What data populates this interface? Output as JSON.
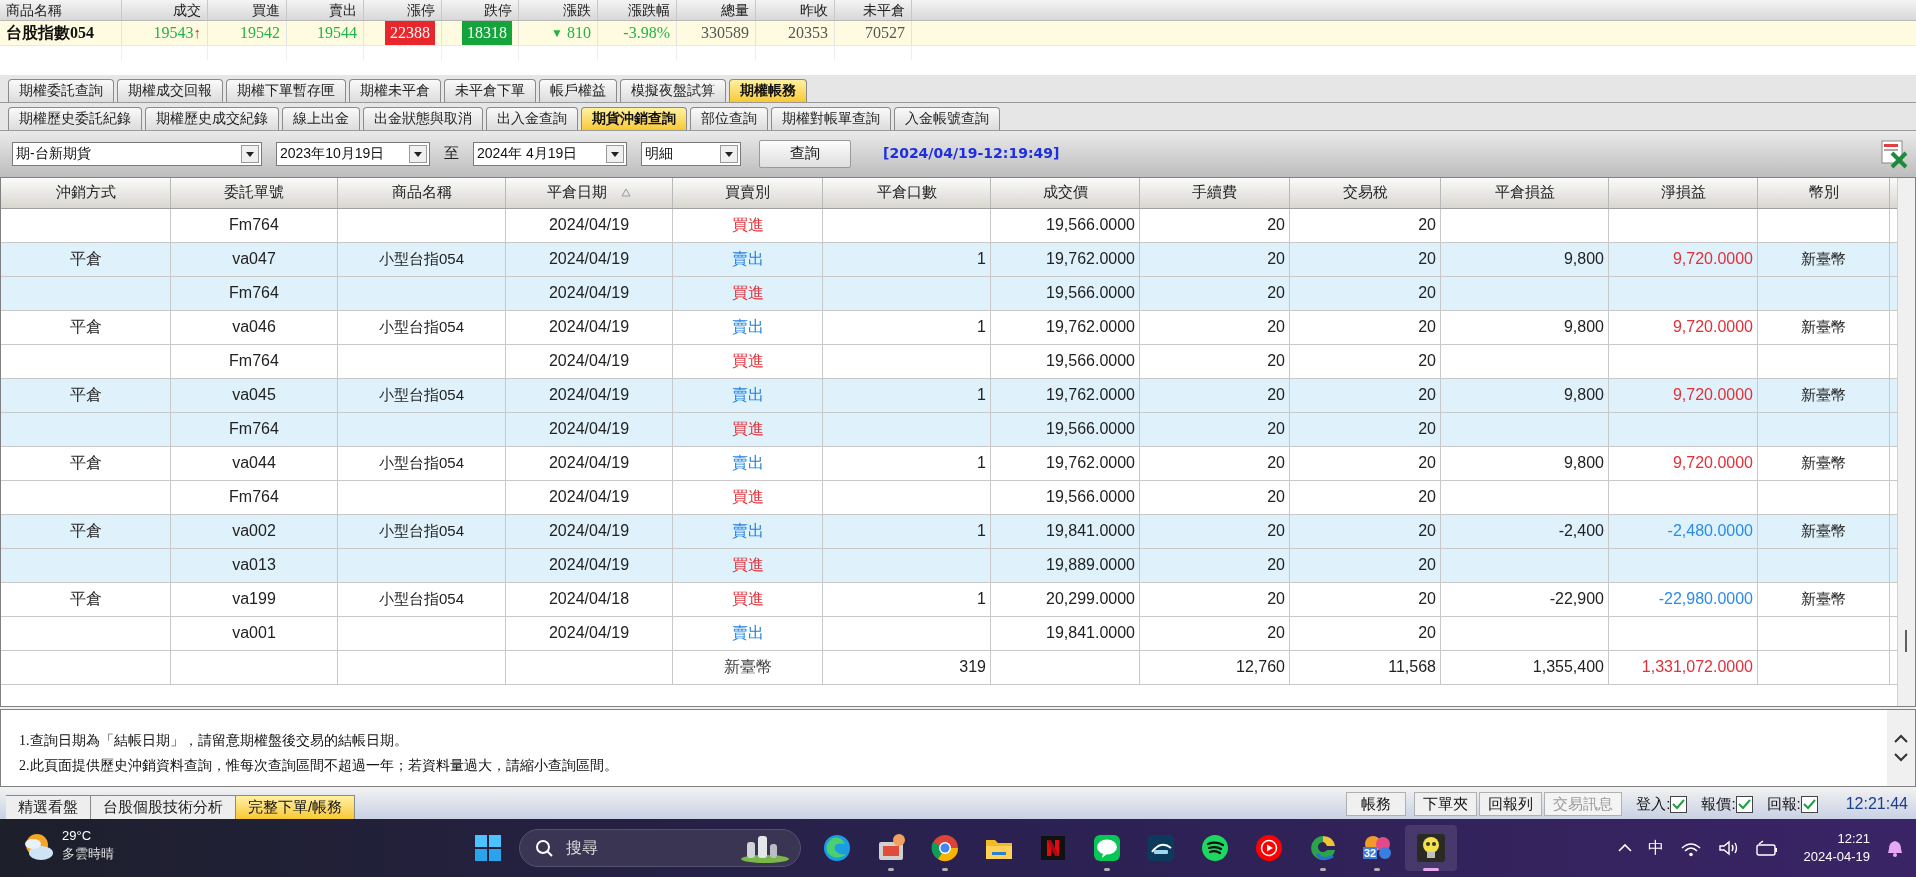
{
  "quote": {
    "columns": [
      "商品名稱",
      "成交",
      "買進",
      "賣出",
      "漲停",
      "跌停",
      "漲跌",
      "漲跌幅",
      "總量",
      "昨收",
      "未平倉"
    ],
    "cells": [
      {
        "text": "台股指數054",
        "kind": "name"
      },
      {
        "text": "19543",
        "mark": "↑",
        "kind": "up"
      },
      {
        "text": "19542",
        "kind": "up"
      },
      {
        "text": "19544",
        "kind": "up"
      },
      {
        "text": "22388",
        "kind": "limit_up"
      },
      {
        "text": "18318",
        "kind": "limit_down"
      },
      {
        "text": "810",
        "mark": "▼",
        "kind": "up"
      },
      {
        "text": "-3.98%",
        "kind": "up"
      },
      {
        "text": "330589",
        "kind": "plain"
      },
      {
        "text": "20353",
        "kind": "plain"
      },
      {
        "text": "70527",
        "kind": "plain"
      }
    ]
  },
  "tabs": [
    {
      "label": "期權委託查詢",
      "selected": false
    },
    {
      "label": "期權成交回報",
      "selected": false
    },
    {
      "label": "期權下單暫存匣",
      "selected": false
    },
    {
      "label": "期權未平倉",
      "selected": false
    },
    {
      "label": "未平倉下單",
      "selected": false
    },
    {
      "label": "帳戶權益",
      "selected": false
    },
    {
      "label": "模擬夜盤試算",
      "selected": false
    },
    {
      "label": "期權帳務",
      "selected": true
    }
  ],
  "subtabs": [
    {
      "label": "期權歷史委託紀錄",
      "selected": false
    },
    {
      "label": "期權歷史成交紀錄",
      "selected": false
    },
    {
      "label": "線上出金",
      "selected": false
    },
    {
      "label": "出金狀態與取消",
      "selected": false
    },
    {
      "label": "出入金查詢",
      "selected": false
    },
    {
      "label": "期貨沖銷查詢",
      "selected": true
    },
    {
      "label": "部位查詢",
      "selected": false
    },
    {
      "label": "期權對帳單查詢",
      "selected": false
    },
    {
      "label": "入金帳號查詢",
      "selected": false
    }
  ],
  "toolbar": {
    "account": "期-台新期貨",
    "start_date": "2023年10月19日",
    "to": "至",
    "end_date": "2024年 4月19日",
    "mode": "明細",
    "query_button": "查詢",
    "timestamp": "[2024/04/19-12:19:49]"
  },
  "table": {
    "columns": [
      {
        "label": "沖銷方式"
      },
      {
        "label": "委託單號"
      },
      {
        "label": "商品名稱"
      },
      {
        "label": "平倉日期",
        "sorted": true
      },
      {
        "label": "買賣別"
      },
      {
        "label": "平倉口數"
      },
      {
        "label": "成交價"
      },
      {
        "label": "手續費"
      },
      {
        "label": "交易稅"
      },
      {
        "label": "平倉損益"
      },
      {
        "label": "淨損益"
      },
      {
        "label": "幣別"
      }
    ],
    "rows": [
      {
        "highlighted": false,
        "buy": true,
        "cells": [
          null,
          "Fm764",
          null,
          "2024/04/19",
          "買進",
          null,
          "19,566.0000",
          "20",
          "20",
          null,
          null,
          null
        ]
      },
      {
        "highlighted": true,
        "buy": false,
        "loss": false,
        "cells": [
          "平倉",
          "va047",
          "小型台指054",
          "2024/04/19",
          "賣出",
          "1",
          "19,762.0000",
          "20",
          "20",
          "9,800",
          "9,720.0000",
          "新臺幣"
        ]
      },
      {
        "highlighted": true,
        "buy": true,
        "cells": [
          null,
          "Fm764",
          null,
          "2024/04/19",
          "買進",
          null,
          "19,566.0000",
          "20",
          "20",
          null,
          null,
          null
        ]
      },
      {
        "highlighted": false,
        "buy": false,
        "loss": false,
        "cells": [
          "平倉",
          "va046",
          "小型台指054",
          "2024/04/19",
          "賣出",
          "1",
          "19,762.0000",
          "20",
          "20",
          "9,800",
          "9,720.0000",
          "新臺幣"
        ]
      },
      {
        "highlighted": false,
        "buy": true,
        "cells": [
          null,
          "Fm764",
          null,
          "2024/04/19",
          "買進",
          null,
          "19,566.0000",
          "20",
          "20",
          null,
          null,
          null
        ]
      },
      {
        "highlighted": true,
        "buy": false,
        "loss": false,
        "cells": [
          "平倉",
          "va045",
          "小型台指054",
          "2024/04/19",
          "賣出",
          "1",
          "19,762.0000",
          "20",
          "20",
          "9,800",
          "9,720.0000",
          "新臺幣"
        ]
      },
      {
        "highlighted": true,
        "buy": true,
        "cells": [
          null,
          "Fm764",
          null,
          "2024/04/19",
          "買進",
          null,
          "19,566.0000",
          "20",
          "20",
          null,
          null,
          null
        ]
      },
      {
        "highlighted": false,
        "buy": false,
        "loss": false,
        "cells": [
          "平倉",
          "va044",
          "小型台指054",
          "2024/04/19",
          "賣出",
          "1",
          "19,762.0000",
          "20",
          "20",
          "9,800",
          "9,720.0000",
          "新臺幣"
        ]
      },
      {
        "highlighted": false,
        "buy": true,
        "cells": [
          null,
          "Fm764",
          null,
          "2024/04/19",
          "買進",
          null,
          "19,566.0000",
          "20",
          "20",
          null,
          null,
          null
        ]
      },
      {
        "highlighted": true,
        "buy": false,
        "loss": true,
        "cells": [
          "平倉",
          "va002",
          "小型台指054",
          "2024/04/19",
          "賣出",
          "1",
          "19,841.0000",
          "20",
          "20",
          "-2,400",
          "-2,480.0000",
          "新臺幣"
        ]
      },
      {
        "highlighted": true,
        "buy": true,
        "cells": [
          null,
          "va013",
          null,
          "2024/04/19",
          "買進",
          null,
          "19,889.0000",
          "20",
          "20",
          null,
          null,
          null
        ]
      },
      {
        "highlighted": false,
        "buy": true,
        "loss": true,
        "cells": [
          "平倉",
          "va199",
          "小型台指054",
          "2024/04/18",
          "買進",
          "1",
          "20,299.0000",
          "20",
          "20",
          "-22,900",
          "-22,980.0000",
          "新臺幣"
        ]
      },
      {
        "highlighted": false,
        "buy": false,
        "cells": [
          null,
          "va001",
          null,
          "2024/04/19",
          "賣出",
          null,
          "19,841.0000",
          "20",
          "20",
          null,
          null,
          null
        ]
      }
    ],
    "total": {
      "loss": false,
      "cells": [
        null,
        null,
        null,
        null,
        "新臺幣",
        "319",
        null,
        "12,760",
        "11,568",
        "1,355,400",
        "1,331,072.0000",
        null
      ]
    }
  },
  "notes": [
    "1.查詢日期為「結帳日期」，請留意期權盤後交易的結帳日期。",
    "2.此頁面提供歷史沖銷資料查詢，惟每次查詢區間不超過一年；若資料量過大，請縮小查詢區間。"
  ],
  "bottom_tabs": [
    {
      "label": "精選看盤",
      "selected": false
    },
    {
      "label": "台股個股技術分析",
      "selected": false
    },
    {
      "label": "完整下單/帳務",
      "selected": true
    }
  ],
  "status_buttons": [
    {
      "label": "帳務",
      "disabled": false
    },
    {
      "label": "下單夾",
      "disabled": false
    },
    {
      "label": "回報列",
      "disabled": false
    },
    {
      "label": "交易訊息",
      "disabled": true
    }
  ],
  "indicators": [
    {
      "label": "登入:",
      "checked": true
    },
    {
      "label": "報價:",
      "checked": true
    },
    {
      "label": "回報:",
      "checked": true
    }
  ],
  "clock": "12:21:44",
  "taskbar": {
    "weather": {
      "temp": "29°C",
      "condition": "多雲時晴"
    },
    "search": {
      "placeholder": "搜尋"
    },
    "apps": [
      {
        "kind": "edge",
        "running": false,
        "active": false
      },
      {
        "kind": "toolbox",
        "running": true,
        "active": false
      },
      {
        "kind": "chrome",
        "running": true,
        "active": false
      },
      {
        "kind": "folder",
        "running": false,
        "active": false
      },
      {
        "kind": "netflix",
        "running": false,
        "active": false
      },
      {
        "kind": "line",
        "running": true,
        "active": false
      },
      {
        "kind": "disney",
        "running": false,
        "active": false
      },
      {
        "kind": "spotify",
        "running": false,
        "active": false
      },
      {
        "kind": "youtube_music",
        "running": false,
        "active": false
      },
      {
        "kind": "swirl",
        "running": true,
        "active": false
      },
      {
        "kind": "badge_app",
        "badge": "32",
        "running": true,
        "active": false
      },
      {
        "kind": "bulb",
        "active": true
      }
    ],
    "tray": {
      "ime": "中",
      "time": "12:21",
      "date": "2024-04-19"
    }
  }
}
